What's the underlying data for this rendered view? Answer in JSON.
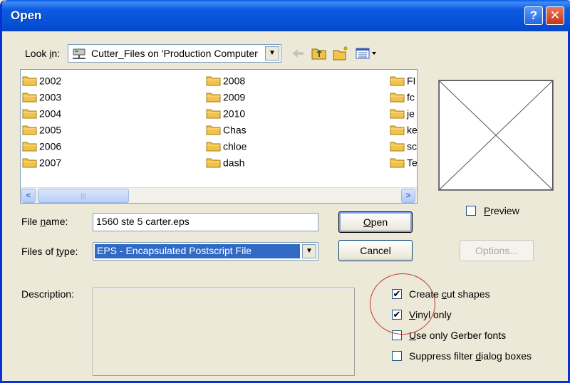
{
  "window": {
    "title": "Open",
    "help_button": "?",
    "close_button": "✕"
  },
  "look_in": {
    "label_prefix": "Look ",
    "label_underlined": "i",
    "label_suffix": "n:",
    "location": "Cutter_Files on 'Production Computer"
  },
  "files": {
    "column1": [
      "2002",
      "2003",
      "2004",
      "2005",
      "2006",
      "2007"
    ],
    "column2": [
      "2008",
      "2009",
      "2010",
      "Chas",
      "chloe",
      "dash"
    ],
    "column3": [
      "FI",
      "fc",
      "je",
      "ke",
      "sc",
      "Te"
    ],
    "scroll_left": "<",
    "scroll_right": ">",
    "scroll_grip": "|||"
  },
  "preview": {
    "label_underlined": "P",
    "label_rest": "review",
    "checked": false
  },
  "file_name": {
    "label_prefix": "File ",
    "label_underlined": "n",
    "label_suffix": "ame:",
    "value": "1560 ste 5 carter.eps"
  },
  "file_type": {
    "label_prefix": "Files of ",
    "label_underlined": "t",
    "label_suffix": "ype:",
    "value": "EPS - Encapsulated Postscript File"
  },
  "buttons": {
    "open_underlined": "O",
    "open_rest": "pen",
    "cancel": "Cancel",
    "options": "Options..."
  },
  "description": {
    "label": "Description:"
  },
  "options_checkboxes": [
    {
      "pre": "Create ",
      "ul": "c",
      "post": "ut shapes",
      "checked": true
    },
    {
      "pre": "",
      "ul": "V",
      "post": "inyl only",
      "checked": true
    },
    {
      "pre": "",
      "ul": "U",
      "post": "se only Gerber fonts",
      "checked": false
    },
    {
      "pre": "Suppress filter ",
      "ul": "d",
      "post": "ialog boxes",
      "checked": false
    }
  ],
  "check_mark": "✔",
  "colors": {
    "title_bar": "#0652d8",
    "selection": "#316ac5",
    "annotation_circle": "#c0392b",
    "folder_yellow": "#f3c24a"
  }
}
